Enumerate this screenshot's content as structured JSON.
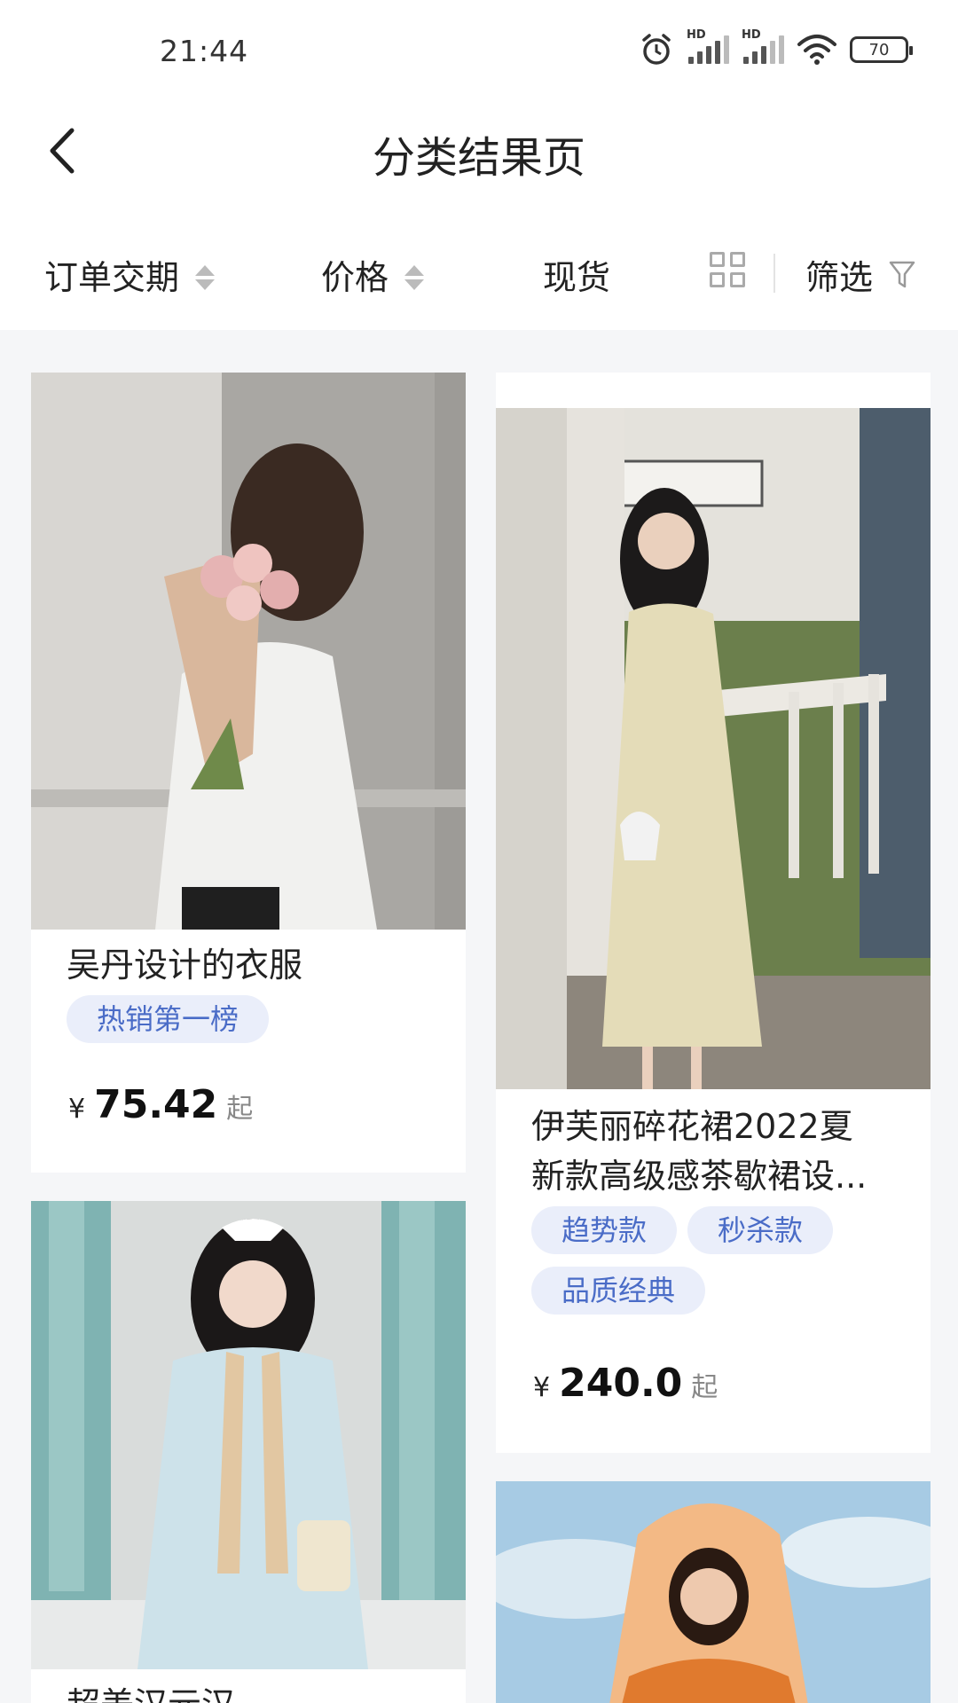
{
  "status": {
    "time": "21:44",
    "battery": "70",
    "hd1": "HD",
    "hd2": "HD"
  },
  "header": {
    "title": "分类结果页"
  },
  "filters": {
    "delivery": "订单交期",
    "price": "价格",
    "in_stock": "现货",
    "filter": "筛选"
  },
  "products": [
    {
      "title": "吴丹设计的衣服",
      "tags": [
        "热销第一榜"
      ],
      "currency": "¥",
      "price": "75.42",
      "suffix": "起"
    },
    {
      "title_line1": "伊芙丽碎花裙2022夏",
      "title_line2": "新款高级感茶歇裙设...",
      "tags": [
        "趋势款",
        "秒杀款",
        "品质经典"
      ],
      "currency": "¥",
      "price": "240.0",
      "suffix": "起"
    },
    {
      "title": "超美汉元汉"
    },
    {
      "title": ""
    }
  ],
  "colors": {
    "accent_tag_bg": "#eaeefa",
    "accent_tag_text": "#4a6cc7",
    "page_bg": "#f5f6f8"
  }
}
